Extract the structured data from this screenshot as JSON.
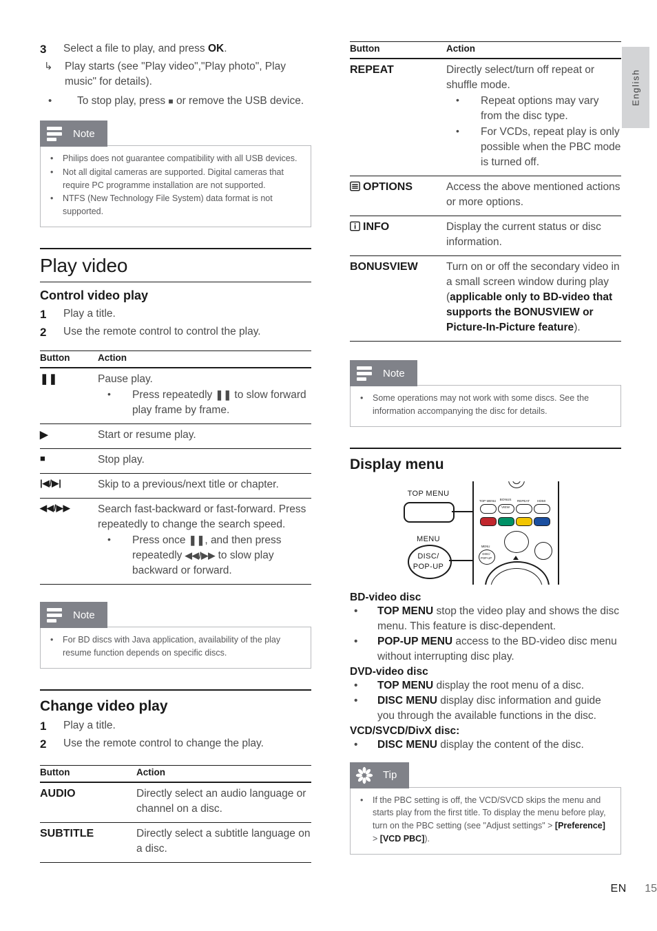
{
  "sidebar": {
    "language_tab": "English"
  },
  "footer": {
    "lang_code": "EN",
    "page_number": "15"
  },
  "left_column": {
    "step3": {
      "number": "3",
      "text_pre": "Select a file to play, and press ",
      "text_bold": "OK",
      "text_post": ".",
      "arrow_mark": "↳",
      "arrow_text": "Play starts (see \"Play video\",\"Play photo\", Play music\" for details).",
      "bullet_mark": "•",
      "bullet_text_pre": "To stop play, press ",
      "bullet_glyph": "■",
      "bullet_text_post": " or remove the USB device."
    },
    "note1": {
      "title": "Note",
      "items": [
        "Philips does not guarantee compatibility with all USB devices.",
        "Not all digital cameras are supported. Digital cameras that require PC programme installation are not supported.",
        "NTFS (New Technology File System) data format is not supported."
      ]
    },
    "heading_play_video": "Play video",
    "control_video_play": {
      "heading": "Control video play",
      "step1_num": "1",
      "step1_text": "Play a title.",
      "step2_num": "2",
      "step2_text": "Use the remote control to control the play."
    },
    "table1": {
      "header_button": "Button",
      "header_action": "Action",
      "rows": [
        {
          "button": "❚❚",
          "action": "Pause play.",
          "sub_bullet": "•",
          "sub_pre": "Press repeatedly ",
          "sub_glyph": "❚❚",
          "sub_post": " to slow forward play frame by frame."
        },
        {
          "button": "▶",
          "action": "Start or resume play."
        },
        {
          "button": "■",
          "action": "Stop play."
        },
        {
          "button": "|◀/▶|",
          "action": "Skip to a previous/next title or chapter."
        },
        {
          "button": "◀◀/▶▶",
          "action": "Search fast-backward or fast-forward. Press repeatedly to change the search speed.",
          "sub_bullet": "•",
          "sub_pre": "Press once ",
          "sub_glyph": "❚❚",
          "sub_mid": ", and then press repeatedly ",
          "sub_glyph2": "◀◀/▶▶",
          "sub_post": " to slow play backward or forward."
        }
      ]
    },
    "note2": {
      "title": "Note",
      "items": [
        "For BD discs with Java application, availability of the play resume function depends on specific discs."
      ]
    },
    "change_video_play": {
      "heading": "Change video play",
      "step1_num": "1",
      "step1_text": "Play a title.",
      "step2_num": "2",
      "step2_text": "Use the remote control to change the play."
    },
    "table2": {
      "header_button": "Button",
      "header_action": "Action",
      "rows": [
        {
          "button": "AUDIO",
          "action": "Directly select an audio language or channel on a disc."
        },
        {
          "button": "SUBTITLE",
          "action": "Directly select a subtitle language on a disc."
        }
      ]
    }
  },
  "right_column": {
    "table3": {
      "header_button": "Button",
      "header_action": "Action",
      "rows": [
        {
          "button": "REPEAT",
          "action": "Directly select/turn off repeat or shuffle mode.",
          "subs": [
            "Repeat options may vary from the disc type.",
            "For VCDs, repeat play is only possible when the PBC mode is turned off."
          ]
        },
        {
          "button": "OPTIONS",
          "icon": "options-list-icon",
          "action": "Access the above mentioned actions or more options."
        },
        {
          "button": "INFO",
          "icon": "info-icon",
          "action": "Display the current status or disc information."
        },
        {
          "button": "BONUSVIEW",
          "action_pre": "Turn on or off the secondary video in a small screen window during play (",
          "action_bold": "applicable only to BD-video that supports the BONUSVIEW or Picture-In-Picture feature",
          "action_post": ")."
        }
      ]
    },
    "note3": {
      "title": "Note",
      "items": [
        "Some operations may not work with some discs. See the information accompanying the disc for details."
      ]
    },
    "display_menu": {
      "heading": "Display menu",
      "remote": {
        "callout_top_label": "TOP MENU",
        "callout_bottom_label_line1": "MENU",
        "callout_bottom_label_line2": "DISC/",
        "callout_bottom_label_line3": "POP-UP",
        "keys": [
          {
            "label": "TOP MENU"
          },
          {
            "label_line1": "BONUS",
            "label_line2": "VIEW"
          },
          {
            "label": "REPEAT"
          },
          {
            "label": "HDMI"
          }
        ],
        "color_keys": [
          "#c1272d",
          "#009166",
          "#f2c500",
          "#1b4fa0"
        ],
        "disc_key_line1": "MENU",
        "disc_key_line2": "DISC/",
        "disc_key_line3": "POP-UP"
      },
      "sections": [
        {
          "title": "BD-video disc",
          "items": [
            {
              "bold": "TOP MENU",
              "text": " stop the video play and shows the disc menu. This feature is disc-dependent."
            },
            {
              "bold": "POP-UP MENU",
              "text": " access to the BD-video disc menu without interrupting disc play."
            }
          ]
        },
        {
          "title": "DVD-video disc",
          "items": [
            {
              "bold": "TOP MENU",
              "text": " display the root menu of a disc."
            },
            {
              "bold": "DISC MENU",
              "text": " display disc information and guide you through the available functions in the disc."
            }
          ]
        },
        {
          "title": "VCD/SVCD/DivX disc:",
          "items": [
            {
              "bold": "DISC MENU",
              "text": " display the content of the disc."
            }
          ]
        }
      ]
    },
    "tip": {
      "title": "Tip",
      "text_pre": "If the PBC setting is off, the VCD/SVCD skips the menu and starts play from the first title. To display the menu before play, turn on the PBC setting (see \"Adjust settings\" > ",
      "bold1": "[Preference]",
      "text_mid": " > ",
      "bold2": "[VCD PBC]",
      "text_post": ")."
    }
  }
}
